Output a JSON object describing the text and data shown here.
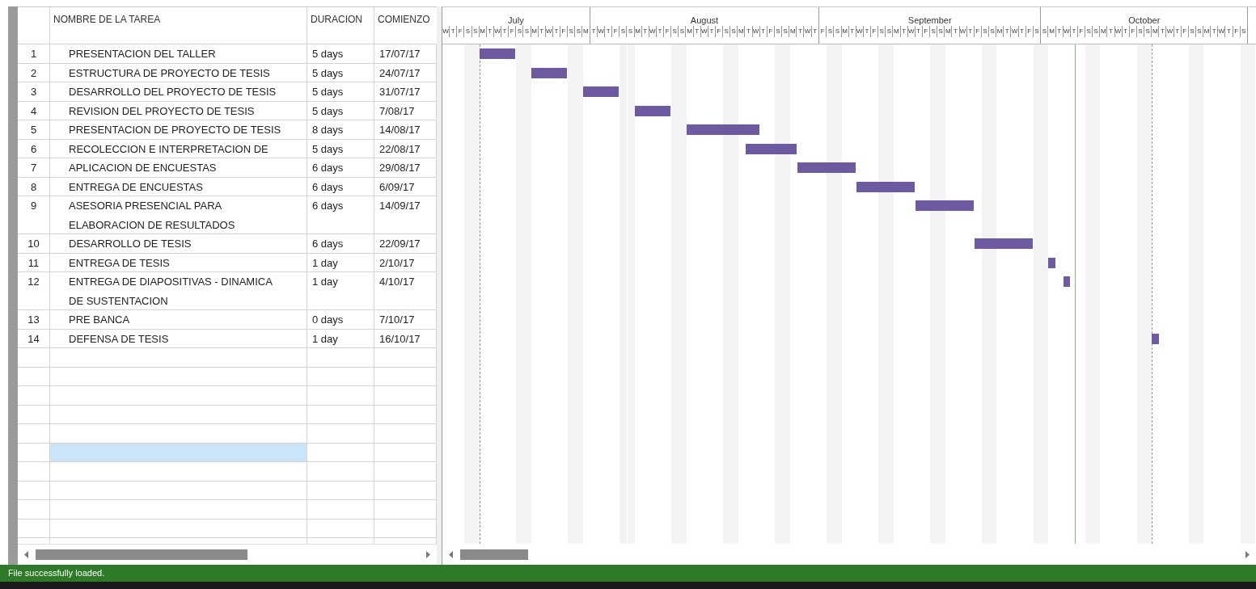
{
  "table": {
    "columns": [
      "NOMBRE DE LA TAREA",
      "DURACION",
      "COMIENZO"
    ],
    "rows": [
      {
        "id": "1",
        "name": [
          "PRESENTACION DEL TALLER"
        ],
        "duration": "5 days",
        "start": "17/07/17"
      },
      {
        "id": "2",
        "name": [
          "ESTRUCTURA DE PROYECTO DE TESIS"
        ],
        "duration": "5 days",
        "start": "24/07/17"
      },
      {
        "id": "3",
        "name": [
          "DESARROLLO DEL PROYECTO DE TESIS"
        ],
        "duration": "5 days",
        "start": "31/07/17"
      },
      {
        "id": "4",
        "name": [
          "REVISION DEL PROYECTO DE TESIS"
        ],
        "duration": "5 days",
        "start": "7/08/17"
      },
      {
        "id": "5",
        "name": [
          "PRESENTACION DE PROYECTO DE TESIS"
        ],
        "duration": "8 days",
        "start": "14/08/17"
      },
      {
        "id": "6",
        "name": [
          "RECOLECCION E INTERPRETACION DE"
        ],
        "duration": "5 days",
        "start": "22/08/17"
      },
      {
        "id": "7",
        "name": [
          "APLICACION DE ENCUESTAS"
        ],
        "duration": "6 days",
        "start": "29/08/17"
      },
      {
        "id": "8",
        "name": [
          "ENTREGA DE ENCUESTAS"
        ],
        "duration": "6 days",
        "start": "6/09/17"
      },
      {
        "id": "9",
        "name": [
          "ASESORIA PRESENCIAL PARA",
          "ELABORACION DE RESULTADOS"
        ],
        "duration": "6 days",
        "start": "14/09/17"
      },
      {
        "id": "10",
        "name": [
          "DESARROLLO DE TESIS"
        ],
        "duration": "6 days",
        "start": "22/09/17"
      },
      {
        "id": "11",
        "name": [
          "ENTREGA DE TESIS"
        ],
        "duration": "1 day",
        "start": "2/10/17"
      },
      {
        "id": "12",
        "name": [
          "ENTREGA DE DIAPOSITIVAS - DINAMICA",
          "DE SUSTENTACION"
        ],
        "duration": "1 day",
        "start": "4/10/17"
      },
      {
        "id": "13",
        "name": [
          "PRE BANCA"
        ],
        "duration": "0 days",
        "start": "7/10/17"
      },
      {
        "id": "14",
        "name": [
          "DEFENSA DE TESIS"
        ],
        "duration": "1 day",
        "start": "16/10/17"
      }
    ],
    "blank_rows": [
      {
        "selected": false
      },
      {
        "selected": false
      },
      {
        "selected": false
      },
      {
        "selected": false
      },
      {
        "selected": false
      },
      {
        "selected": true
      },
      {
        "selected": false
      },
      {
        "selected": false
      },
      {
        "selected": false
      },
      {
        "selected": false
      }
    ]
  },
  "timeline": {
    "months": [
      {
        "name": "July",
        "days": [
          "W",
          "T",
          "F",
          "S",
          "S",
          "M",
          "T",
          "W",
          "T",
          "F",
          "S",
          "S",
          "M",
          "T",
          "W",
          "T",
          "F",
          "S",
          "S",
          "M"
        ]
      },
      {
        "name": "August",
        "days": [
          "T",
          "W",
          "T",
          "F",
          "S",
          "S",
          "M",
          "T",
          "W",
          "T",
          "F",
          "S",
          "S",
          "M",
          "T",
          "W",
          "T",
          "F",
          "S",
          "S",
          "M",
          "T",
          "W",
          "T",
          "F",
          "S",
          "S",
          "M",
          "T",
          "W",
          "T"
        ]
      },
      {
        "name": "September",
        "days": [
          "F",
          "S",
          "S",
          "M",
          "T",
          "W",
          "T",
          "F",
          "S",
          "S",
          "M",
          "T",
          "W",
          "T",
          "F",
          "S",
          "S",
          "M",
          "T",
          "W",
          "T",
          "F",
          "S",
          "S",
          "M",
          "T",
          "W",
          "T",
          "F",
          "S"
        ]
      },
      {
        "name": "October",
        "days": [
          "S",
          "M",
          "T",
          "W",
          "T",
          "F",
          "S",
          "S",
          "M",
          "T",
          "W",
          "T",
          "F",
          "S",
          "S",
          "M",
          "T",
          "W",
          "T",
          "F",
          "S",
          "S",
          "M",
          "T",
          "W",
          "T",
          "F",
          "S"
        ]
      }
    ]
  },
  "status_bar": "File successfully loaded."
}
